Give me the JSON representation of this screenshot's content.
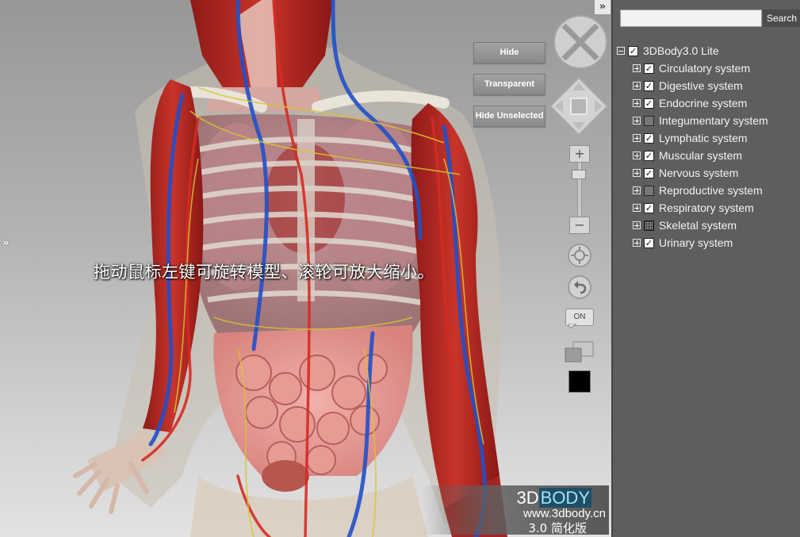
{
  "viewport": {
    "instruction": "拖动鼠标左键可旋转模型、滚轮可放大缩小。",
    "expand_left_arrow": "»",
    "collapse_right_arrow": "»",
    "buttons": {
      "hide": "Hide",
      "transparent": "Transparent",
      "hide_unselected": "Hide Unselected"
    },
    "controls": {
      "zoom_in": "+",
      "zoom_out": "−",
      "toggle": "ON",
      "bg_color": "#000000"
    },
    "logo": {
      "brand_a": "3D",
      "brand_b": "BODY",
      "url": "www.3dbody.cn",
      "version": "3.0 简化版"
    }
  },
  "panel": {
    "search": {
      "placeholder": "",
      "value": "",
      "button": "Search"
    },
    "tree": {
      "root": {
        "label": "3DBody3.0 Lite",
        "expanded": true,
        "checked": "checked"
      },
      "items": [
        {
          "label": "Circulatory system",
          "checked": "checked"
        },
        {
          "label": "Digestive system",
          "checked": "checked"
        },
        {
          "label": "Endocrine system",
          "checked": "checked"
        },
        {
          "label": "Integumentary system",
          "checked": "unchecked"
        },
        {
          "label": "Lymphatic system",
          "checked": "checked"
        },
        {
          "label": "Muscular system",
          "checked": "checked"
        },
        {
          "label": "Nervous system",
          "checked": "checked"
        },
        {
          "label": "Reproductive system",
          "checked": "unchecked"
        },
        {
          "label": "Respiratory system",
          "checked": "checked"
        },
        {
          "label": "Skeletal system",
          "checked": "partial"
        },
        {
          "label": "Urinary system",
          "checked": "checked"
        }
      ]
    }
  }
}
